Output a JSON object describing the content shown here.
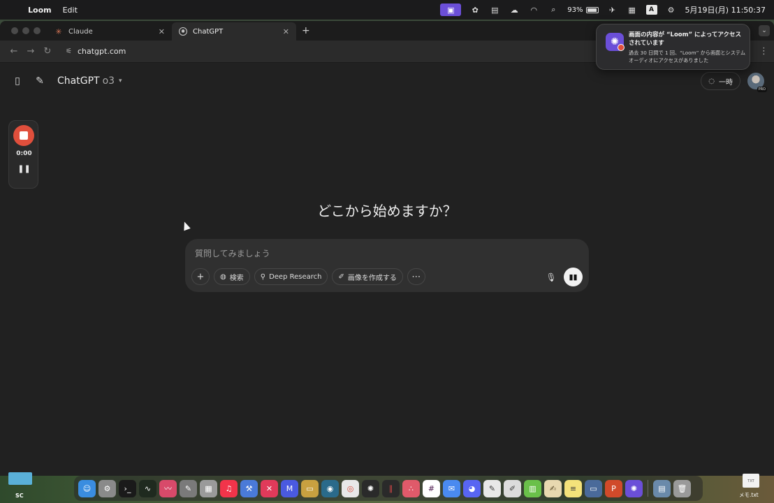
{
  "menubar": {
    "app_name": "Loom",
    "menus": [
      "Edit"
    ],
    "battery": "93%",
    "input_indicator": "A",
    "datetime": "5月19日(月) 11:50:37"
  },
  "browser": {
    "tabs": [
      {
        "title": "Claude",
        "favicon": "claude-icon"
      },
      {
        "title": "ChatGPT",
        "favicon": "chatgpt-icon"
      }
    ],
    "url": "chatgpt.com"
  },
  "chatgpt": {
    "model_name": "ChatGPT",
    "model_version": "o3",
    "temporary_label": "一時",
    "avatar_badge": "PRO",
    "greeting": "どこから始めますか？",
    "composer": {
      "placeholder": "質問してみましょう",
      "search_label": "検索",
      "deep_research_label": "Deep Research",
      "create_image_label": "画像を作成する"
    }
  },
  "recorder": {
    "time": "0:00"
  },
  "notification": {
    "title": "画面の内容が “Loom” によってアクセスされています",
    "body": "過去 30 日間で 1 回、“Loom” から画面とシステムオーディオにアクセスがありました"
  },
  "desktop": {
    "left_item_label": "SC",
    "right_item_label": "メモ.txt",
    "right_item_badge": "TXT"
  },
  "colors": {
    "loom_purple": "#6b4fd8",
    "record_red": "#e04f3c",
    "page_bg": "#212121",
    "composer_bg": "#303030"
  }
}
